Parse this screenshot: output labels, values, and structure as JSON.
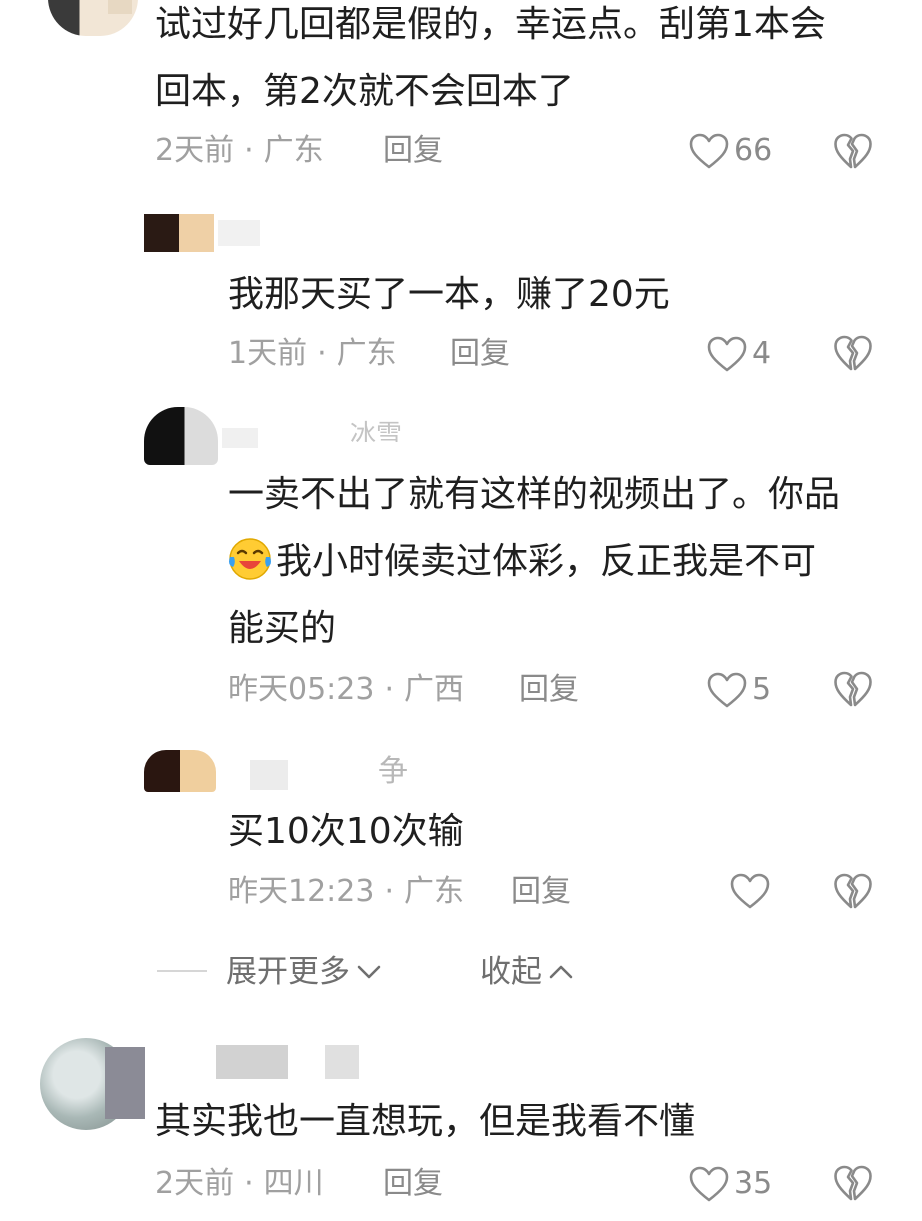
{
  "comments": [
    {
      "text_lines": [
        "试过好几回都是假的，幸运点。刮第1本会",
        "回本，第2次就不会回本了"
      ],
      "time": "2天前",
      "location": "广东",
      "reply_label": "回复",
      "likes": "66"
    },
    {
      "text_lines": [
        "我那天买了一本，赚了20元"
      ],
      "time": "1天前",
      "location": "广东",
      "reply_label": "回复",
      "likes": "4"
    },
    {
      "username_fragment": "冰雪",
      "text_lines": [
        "一卖不出了就有这样的视频出了。你品",
        "我小时候卖过体彩，反正我是不可",
        "能买的"
      ],
      "time": "昨天05:23",
      "location": "广西",
      "reply_label": "回复",
      "likes": "5"
    },
    {
      "username_fragment": "争",
      "text_lines": [
        "买10次10次输"
      ],
      "time": "昨天12:23",
      "location": "广东",
      "reply_label": "回复",
      "likes": ""
    },
    {
      "text_lines": [
        "其实我也一直想玩，但是我看不懂"
      ],
      "time": "2天前",
      "location": "四川",
      "reply_label": "回复",
      "likes": "35"
    }
  ],
  "controls": {
    "expand_label": "展开更多",
    "collapse_label": "收起"
  },
  "meta_separator": "·",
  "colors": {
    "text": "#1f1f1f",
    "meta": "#a0a0a0",
    "icon": "#8a8a8a",
    "background": "#ffffff"
  },
  "icons": {
    "like": "heart-outline-icon",
    "dislike": "broken-heart-icon",
    "expand": "chevron-down-icon",
    "collapse": "chevron-up-icon",
    "emoji": "laughing-crying-emoji-icon"
  }
}
